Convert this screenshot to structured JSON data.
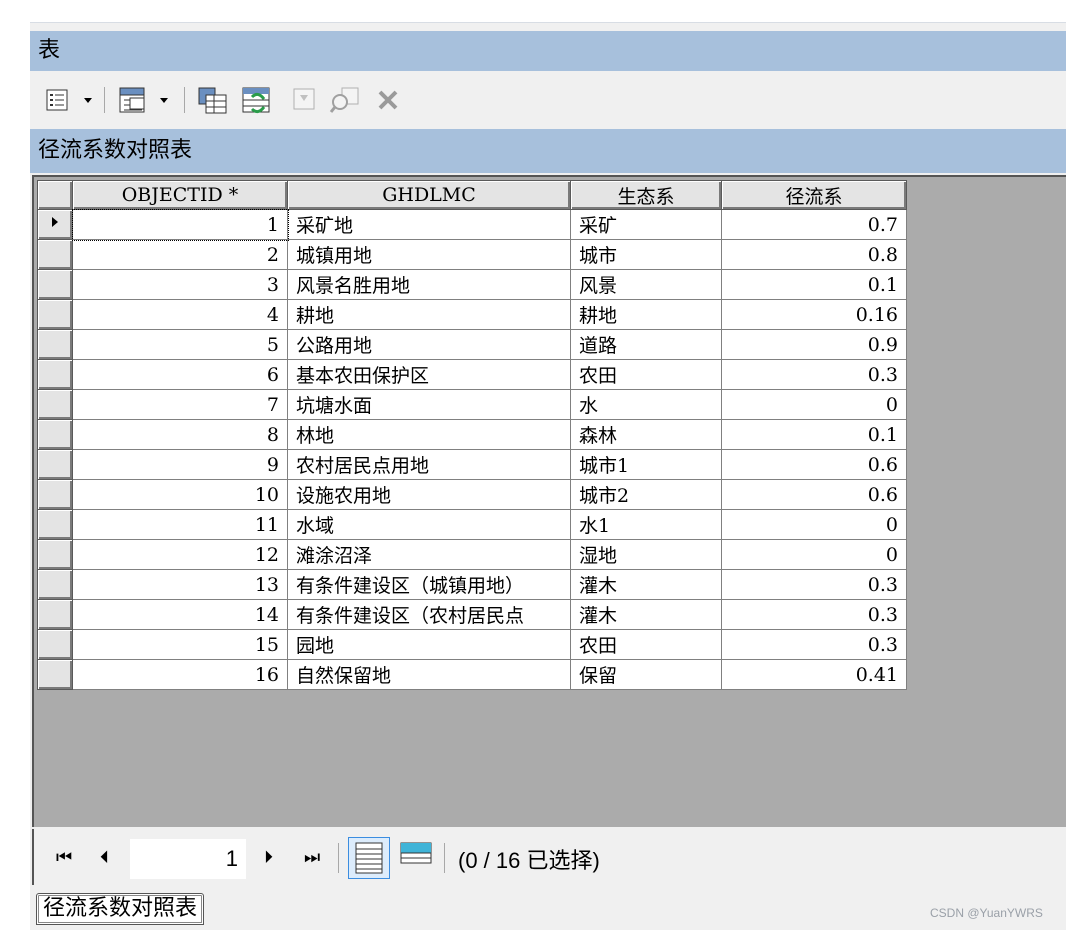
{
  "window": {
    "title": "表"
  },
  "toolbar": {
    "icons": [
      "table-options-icon",
      "related-tables-icon",
      "select-by-attributes-icon",
      "switch-selection-icon",
      "clear-selection-icon",
      "zoom-to-selected-icon",
      "delete-selected-icon"
    ]
  },
  "table_title": "径流系数对照表",
  "columns": [
    "OBJECTID *",
    "GHDLMC",
    "生态系",
    "径流系"
  ],
  "rows": [
    [
      "1",
      "采矿地",
      "采矿",
      "0.7"
    ],
    [
      "2",
      "城镇用地",
      "城市",
      "0.8"
    ],
    [
      "3",
      "风景名胜用地",
      "风景",
      "0.1"
    ],
    [
      "4",
      "耕地",
      "耕地",
      "0.16"
    ],
    [
      "5",
      "公路用地",
      "道路",
      "0.9"
    ],
    [
      "6",
      "基本农田保护区",
      "农田",
      "0.3"
    ],
    [
      "7",
      "坑塘水面",
      "水",
      "0"
    ],
    [
      "8",
      "林地",
      "森林",
      "0.1"
    ],
    [
      "9",
      "农村居民点用地",
      "城市1",
      "0.6"
    ],
    [
      "10",
      "设施农用地",
      "城市2",
      "0.6"
    ],
    [
      "11",
      "水域",
      "水1",
      "0"
    ],
    [
      "12",
      "滩涂沼泽",
      "湿地",
      "0"
    ],
    [
      "13",
      "有条件建设区（城镇用地）",
      "灌木",
      "0.3"
    ],
    [
      "14",
      "有条件建设区（农村居民点",
      "灌木",
      "0.3"
    ],
    [
      "15",
      "园地",
      "农田",
      "0.3"
    ],
    [
      "16",
      "自然保留地",
      "保留",
      "0.41"
    ]
  ],
  "navigation": {
    "current_record": "1",
    "status": "(0 / 16 已选择)"
  },
  "tab": {
    "label": "径流系数对照表"
  },
  "watermark": "CSDN @YuanYWRS",
  "colors": {
    "title_bar": "#a7c0dc",
    "grid_bg": "#ababab"
  }
}
